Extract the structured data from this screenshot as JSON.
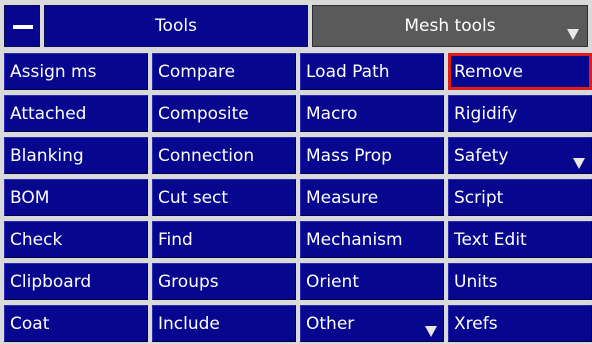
{
  "header": {
    "tools_label": "Tools",
    "mesh_tools_label": "Mesh tools",
    "minimize_icon": "minus-icon",
    "dropdown_icon": "triangle-down-icon"
  },
  "colors": {
    "button_blue": "#06068f",
    "dark_button": "#5a5a5a",
    "selected_border": "#e01b1b",
    "text": "#ffffff"
  },
  "buttons": [
    {
      "label": "Assign ms"
    },
    {
      "label": "Compare"
    },
    {
      "label": "Load Path"
    },
    {
      "label": "Remove",
      "selected": true
    },
    {
      "label": "Attached"
    },
    {
      "label": "Composite"
    },
    {
      "label": "Macro"
    },
    {
      "label": "Rigidify"
    },
    {
      "label": "Blanking"
    },
    {
      "label": "Connection"
    },
    {
      "label": "Mass Prop"
    },
    {
      "label": "Safety",
      "has_dropdown": true
    },
    {
      "label": "BOM"
    },
    {
      "label": "Cut sect"
    },
    {
      "label": "Measure"
    },
    {
      "label": "Script"
    },
    {
      "label": "Check"
    },
    {
      "label": "Find"
    },
    {
      "label": "Mechanism"
    },
    {
      "label": "Text Edit"
    },
    {
      "label": "Clipboard"
    },
    {
      "label": "Groups"
    },
    {
      "label": "Orient"
    },
    {
      "label": "Units"
    },
    {
      "label": "Coat"
    },
    {
      "label": "Include"
    },
    {
      "label": "Other",
      "has_dropdown": true
    },
    {
      "label": "Xrefs"
    }
  ]
}
